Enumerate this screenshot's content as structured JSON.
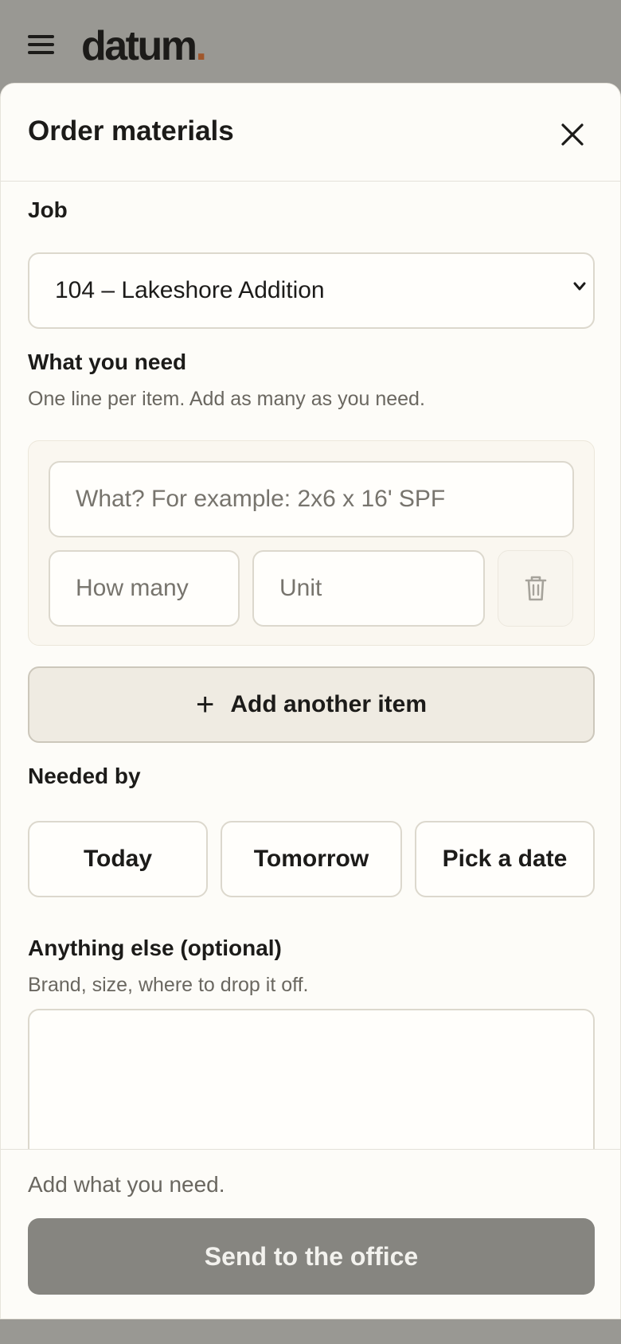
{
  "brand": {
    "logo_text": "datum",
    "logo_dot": ".",
    "accent_color": "#a0572c"
  },
  "topbar": {
    "menu_icon": "hamburger-menu-icon"
  },
  "sheet": {
    "title": "Order materials",
    "close_icon": "close-icon"
  },
  "job": {
    "label": "Job",
    "selected": "104 – Lakeshore Addition"
  },
  "items": {
    "label": "What you need",
    "hint": "One line per item. Add as many as you need.",
    "what_placeholder": "What? For example: 2x6 x 16' SPF",
    "qty_placeholder": "How many",
    "unit_placeholder": "Unit",
    "delete_icon": "trash-icon",
    "add_label": "Add another item",
    "add_icon": "plus-icon"
  },
  "needed_by": {
    "label": "Needed by",
    "options": [
      "Today",
      "Tomorrow",
      "Pick a date"
    ]
  },
  "notes": {
    "label": "Anything else (optional)",
    "hint": "Brand, size, where to drop it off.",
    "value": ""
  },
  "footer": {
    "status": "Add what you need.",
    "submit_label": "Send to the office",
    "submit_color": "#868580"
  }
}
